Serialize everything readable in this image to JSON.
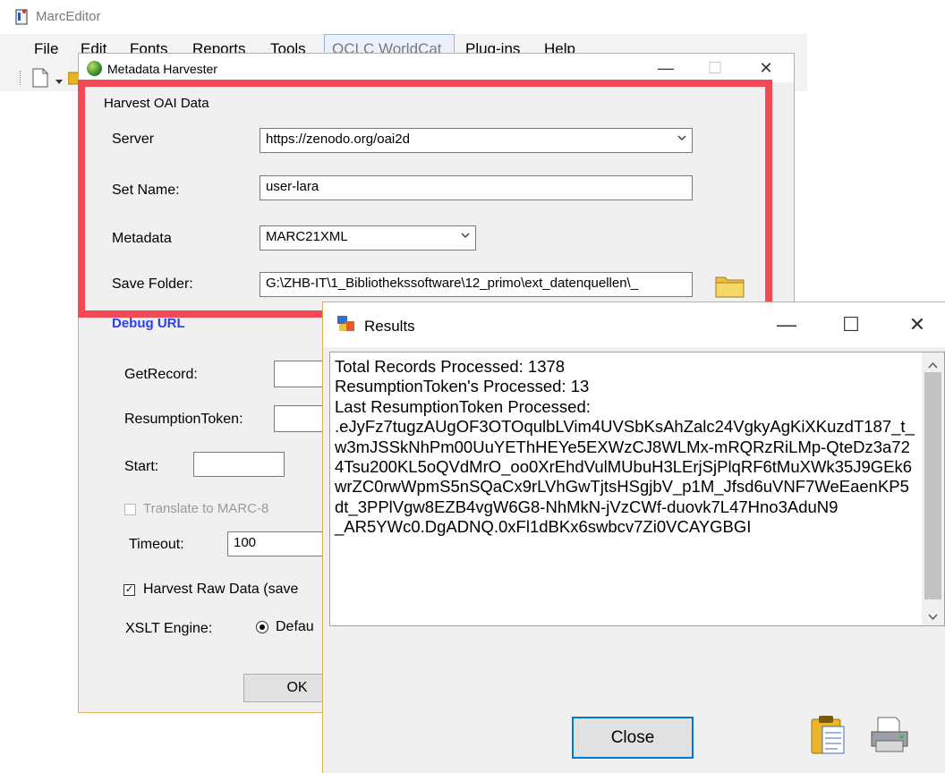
{
  "app": {
    "title": "MarcEditor",
    "menu": [
      "File",
      "Edit",
      "Fonts",
      "Reports",
      "Tools",
      "OCLC WorldCat",
      "Plug-ins",
      "Help"
    ]
  },
  "harvester": {
    "title": "Metadata Harvester",
    "section_title": "Harvest OAI Data",
    "server_label": "Server",
    "server_value": "https://zenodo.org/oai2d",
    "setname_label": "Set Name:",
    "setname_value": "user-lara",
    "metadata_label": "Metadata",
    "metadata_value": "MARC21XML",
    "savefolder_label": "Save Folder:",
    "savefolder_value": "G:\\ZHB-IT\\1_Bibliothekssoftware\\12_primo\\ext_datenquellen\\_",
    "debug_link": "Debug URL",
    "getrecord_label": "GetRecord:",
    "resumption_label": "ResumptionToken:",
    "start_label": "Start:",
    "translate_label": "Translate to MARC-8",
    "timeout_label": "Timeout:",
    "timeout_value": "100",
    "harvest_raw_label": "Harvest Raw Data (save",
    "xslt_label": "XSLT Engine:",
    "xslt_option": "Defau",
    "ok_label": "OK"
  },
  "results": {
    "title": "Results",
    "text": "Total Records Processed: 1378\nResumptionToken's Processed: 13\nLast ResumptionToken Processed:\n.eJyFz7tugzAUgOF3OTOqulbLVim4UVSbKsAhZalc24VgkyAgKiXKuzdT187_t_w3mJSSkNhPm00UuYEThHEYe5EXWzCJ8WLMx-mRQRzRiLMp-QteDz3a724Tsu200KL5oQVdMrO_oo0XrEhdVulMUbuH3LErjSjPlqRF6tMuXWk35J9GEk6wrZC0rwWpmS5nSQaCx9rLVhGwTjtsHSgjbV_p1M_Jfsd6uVNF7WeEaenKP5dt_3PPlVgw8EZB4vgW6G8-NhMkN-jVzCWf-duovk7L47Hno3AduN9\n_AR5YWc0.DgADNQ.0xFl1dBKx6swbcv7Zi0VCAYGBGI",
    "close_label": "Close"
  }
}
